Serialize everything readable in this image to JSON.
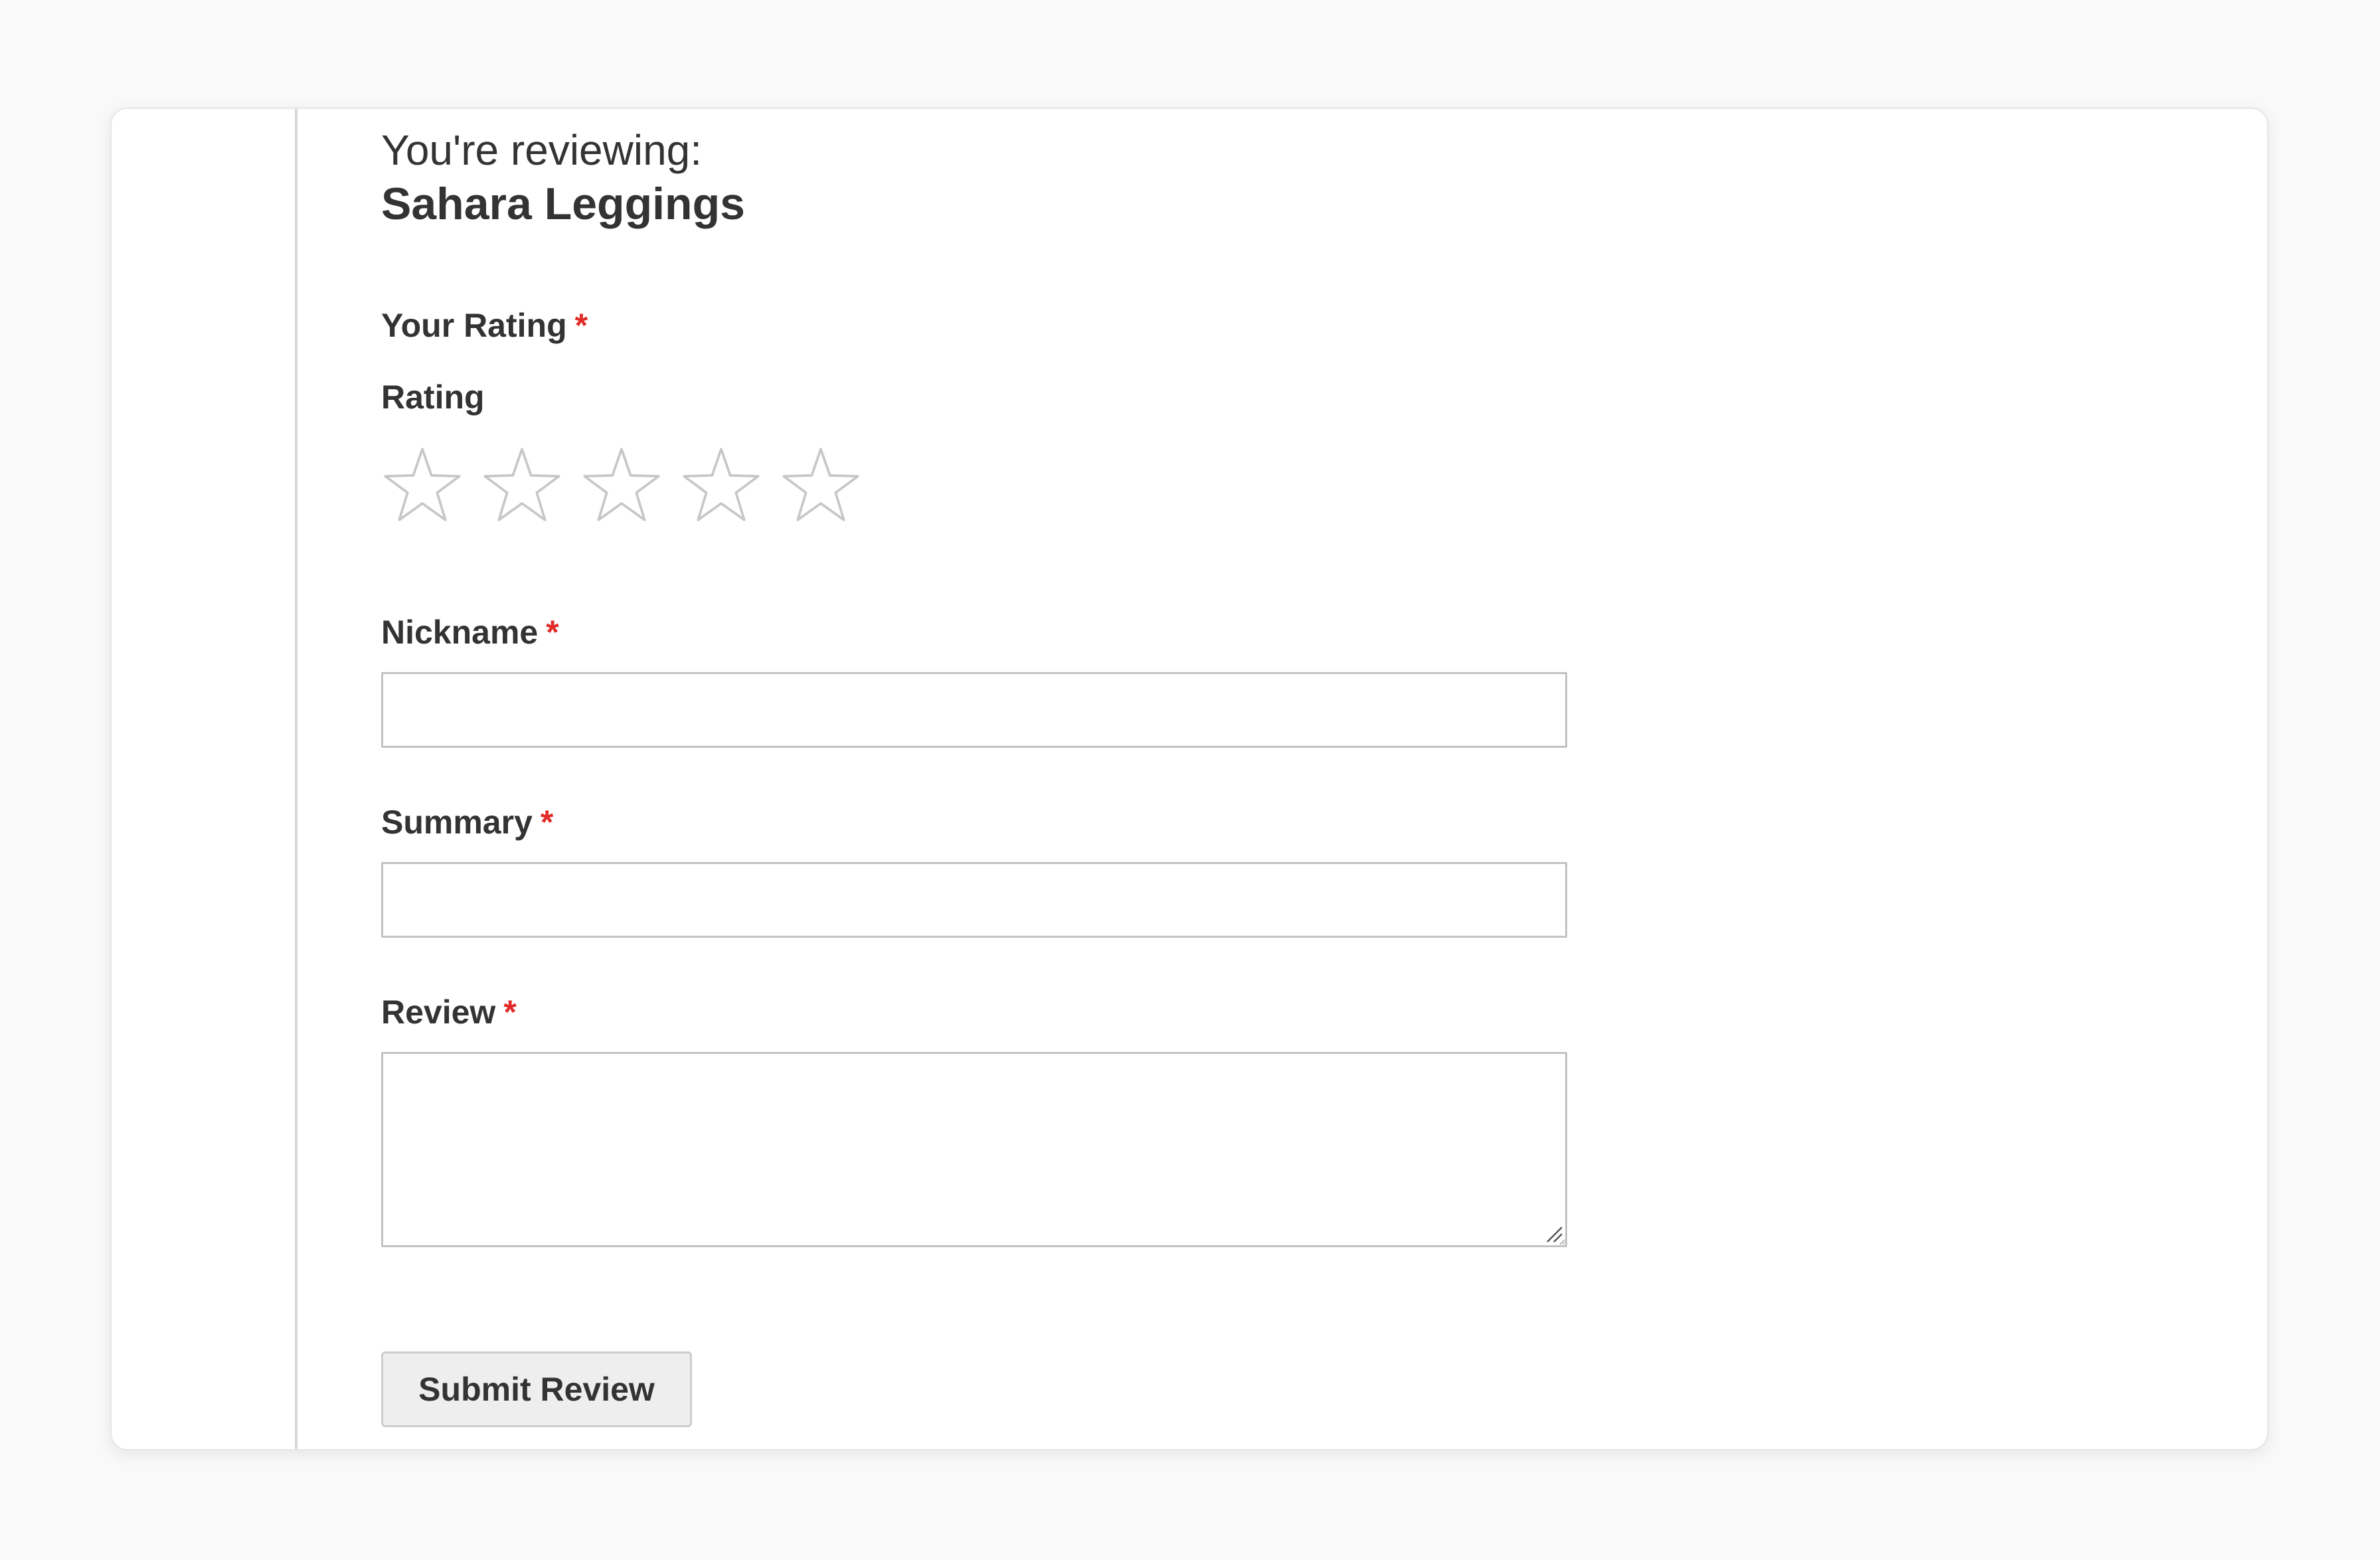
{
  "form": {
    "legend": "You're reviewing:",
    "product_name": "Sahara Leggings",
    "rating_section": {
      "label": "Your Rating",
      "required_mark": "*",
      "sublabel": "Rating",
      "stars": [
        {
          "icon": "star-outline-icon",
          "value": 1
        },
        {
          "icon": "star-outline-icon",
          "value": 2
        },
        {
          "icon": "star-outline-icon",
          "value": 3
        },
        {
          "icon": "star-outline-icon",
          "value": 4
        },
        {
          "icon": "star-outline-icon",
          "value": 5
        }
      ],
      "selected": 0,
      "max": 5
    },
    "nickname": {
      "label": "Nickname",
      "required_mark": "*",
      "value": "",
      "placeholder": ""
    },
    "summary": {
      "label": "Summary",
      "required_mark": "*",
      "value": "",
      "placeholder": ""
    },
    "review": {
      "label": "Review",
      "required_mark": "*",
      "value": "",
      "placeholder": ""
    },
    "submit_label": "Submit Review"
  },
  "colors": {
    "page_background": "#f9f9f9",
    "card_background": "#ffffff",
    "text": "#333333",
    "required": "#e02b27",
    "star_outline": "#c7c7c7",
    "input_border": "#c2c2c2",
    "button_background": "#eeeeee"
  }
}
